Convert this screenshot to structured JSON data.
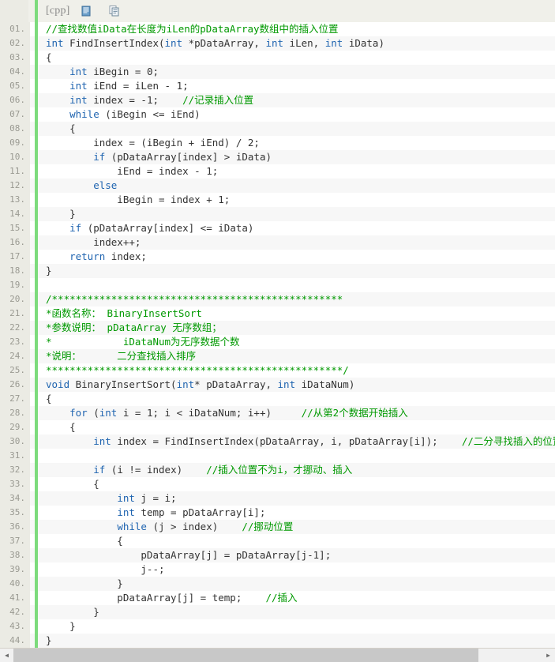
{
  "toolbar": {
    "lang_label": "[cpp]",
    "view_icon_name": "view-plain-icon",
    "copy_icon_name": "copy-to-clipboard-icon"
  },
  "scrollbar": {
    "left_arrow": "◀",
    "right_arrow": "▶"
  },
  "colors": {
    "keyword": "#1f64b0",
    "comment": "#009900",
    "text": "#333333",
    "gutter_bg": "#ebebe4",
    "accent_bar": "#7ddb7d",
    "stripe_bg": "#f7f7f7"
  },
  "code": {
    "language": "cpp",
    "line_count": 44,
    "lines": [
      {
        "n": "01.",
        "segments": [
          {
            "t": "//查找数值iData在长度为iLen的pDataArray数组中的插入位置",
            "c": "cmt"
          }
        ]
      },
      {
        "n": "02.",
        "segments": [
          {
            "t": "int",
            "c": "kw"
          },
          {
            "t": " FindInsertIndex(",
            "c": ""
          },
          {
            "t": "int",
            "c": "kw"
          },
          {
            "t": " *pDataArray, ",
            "c": ""
          },
          {
            "t": "int",
            "c": "kw"
          },
          {
            "t": " iLen, ",
            "c": ""
          },
          {
            "t": "int",
            "c": "kw"
          },
          {
            "t": " iData)",
            "c": ""
          }
        ]
      },
      {
        "n": "03.",
        "segments": [
          {
            "t": "{",
            "c": ""
          }
        ]
      },
      {
        "n": "04.",
        "segments": [
          {
            "t": "    ",
            "c": ""
          },
          {
            "t": "int",
            "c": "kw"
          },
          {
            "t": " iBegin = 0;",
            "c": ""
          }
        ]
      },
      {
        "n": "05.",
        "segments": [
          {
            "t": "    ",
            "c": ""
          },
          {
            "t": "int",
            "c": "kw"
          },
          {
            "t": " iEnd = iLen - 1;",
            "c": ""
          }
        ]
      },
      {
        "n": "06.",
        "segments": [
          {
            "t": "    ",
            "c": ""
          },
          {
            "t": "int",
            "c": "kw"
          },
          {
            "t": " index = -1;    ",
            "c": ""
          },
          {
            "t": "//记录插入位置",
            "c": "cmt"
          }
        ]
      },
      {
        "n": "07.",
        "segments": [
          {
            "t": "    ",
            "c": ""
          },
          {
            "t": "while",
            "c": "kw"
          },
          {
            "t": " (iBegin <= iEnd)",
            "c": ""
          }
        ]
      },
      {
        "n": "08.",
        "segments": [
          {
            "t": "    {",
            "c": ""
          }
        ]
      },
      {
        "n": "09.",
        "segments": [
          {
            "t": "        index = (iBegin + iEnd) / 2;",
            "c": ""
          }
        ]
      },
      {
        "n": "10.",
        "segments": [
          {
            "t": "        ",
            "c": ""
          },
          {
            "t": "if",
            "c": "kw"
          },
          {
            "t": " (pDataArray[index] > iData)",
            "c": ""
          }
        ]
      },
      {
        "n": "11.",
        "segments": [
          {
            "t": "            iEnd = index - 1;",
            "c": ""
          }
        ]
      },
      {
        "n": "12.",
        "segments": [
          {
            "t": "        ",
            "c": ""
          },
          {
            "t": "else",
            "c": "kw"
          }
        ]
      },
      {
        "n": "13.",
        "segments": [
          {
            "t": "            iBegin = index + 1;",
            "c": ""
          }
        ]
      },
      {
        "n": "14.",
        "segments": [
          {
            "t": "    }",
            "c": ""
          }
        ]
      },
      {
        "n": "15.",
        "segments": [
          {
            "t": "    ",
            "c": ""
          },
          {
            "t": "if",
            "c": "kw"
          },
          {
            "t": " (pDataArray[index] <= iData)",
            "c": ""
          }
        ]
      },
      {
        "n": "16.",
        "segments": [
          {
            "t": "        index++;",
            "c": ""
          }
        ]
      },
      {
        "n": "17.",
        "segments": [
          {
            "t": "    ",
            "c": ""
          },
          {
            "t": "return",
            "c": "kw"
          },
          {
            "t": " index;",
            "c": ""
          }
        ]
      },
      {
        "n": "18.",
        "segments": [
          {
            "t": "}",
            "c": ""
          }
        ]
      },
      {
        "n": "19.",
        "segments": [
          {
            "t": "",
            "c": ""
          }
        ]
      },
      {
        "n": "20.",
        "segments": [
          {
            "t": "/*************************************************",
            "c": "cmt"
          }
        ]
      },
      {
        "n": "21.",
        "segments": [
          {
            "t": "*函数名称： BinaryInsertSort",
            "c": "cmt"
          }
        ]
      },
      {
        "n": "22.",
        "segments": [
          {
            "t": "*参数说明： pDataArray 无序数组；",
            "c": "cmt"
          }
        ]
      },
      {
        "n": "23.",
        "segments": [
          {
            "t": "*            iDataNum为无序数据个数",
            "c": "cmt"
          }
        ]
      },
      {
        "n": "24.",
        "segments": [
          {
            "t": "*说明：      二分查找插入排序",
            "c": "cmt"
          }
        ]
      },
      {
        "n": "25.",
        "segments": [
          {
            "t": "**************************************************/",
            "c": "cmt"
          }
        ]
      },
      {
        "n": "26.",
        "segments": [
          {
            "t": "void",
            "c": "kw"
          },
          {
            "t": " BinaryInsertSort(",
            "c": ""
          },
          {
            "t": "int",
            "c": "kw"
          },
          {
            "t": "* pDataArray, ",
            "c": ""
          },
          {
            "t": "int",
            "c": "kw"
          },
          {
            "t": " iDataNum)",
            "c": ""
          }
        ]
      },
      {
        "n": "27.",
        "segments": [
          {
            "t": "{",
            "c": ""
          }
        ]
      },
      {
        "n": "28.",
        "segments": [
          {
            "t": "    ",
            "c": ""
          },
          {
            "t": "for",
            "c": "kw"
          },
          {
            "t": " (",
            "c": ""
          },
          {
            "t": "int",
            "c": "kw"
          },
          {
            "t": " i = 1; i < iDataNum; i++)     ",
            "c": ""
          },
          {
            "t": "//从第2个数据开始插入",
            "c": "cmt"
          }
        ]
      },
      {
        "n": "29.",
        "segments": [
          {
            "t": "    {",
            "c": ""
          }
        ]
      },
      {
        "n": "30.",
        "segments": [
          {
            "t": "        ",
            "c": ""
          },
          {
            "t": "int",
            "c": "kw"
          },
          {
            "t": " index = FindInsertIndex(pDataArray, i, pDataArray[i]);    ",
            "c": ""
          },
          {
            "t": "//二分寻找插入的位置",
            "c": "cmt"
          }
        ]
      },
      {
        "n": "31.",
        "segments": [
          {
            "t": "",
            "c": ""
          }
        ]
      },
      {
        "n": "32.",
        "segments": [
          {
            "t": "        ",
            "c": ""
          },
          {
            "t": "if",
            "c": "kw"
          },
          {
            "t": " (i != index)    ",
            "c": ""
          },
          {
            "t": "//插入位置不为i，才挪动、插入",
            "c": "cmt"
          }
        ]
      },
      {
        "n": "33.",
        "segments": [
          {
            "t": "        {",
            "c": ""
          }
        ]
      },
      {
        "n": "34.",
        "segments": [
          {
            "t": "            ",
            "c": ""
          },
          {
            "t": "int",
            "c": "kw"
          },
          {
            "t": " j = i;",
            "c": ""
          }
        ]
      },
      {
        "n": "35.",
        "segments": [
          {
            "t": "            ",
            "c": ""
          },
          {
            "t": "int",
            "c": "kw"
          },
          {
            "t": " temp = pDataArray[i];",
            "c": ""
          }
        ]
      },
      {
        "n": "36.",
        "segments": [
          {
            "t": "            ",
            "c": ""
          },
          {
            "t": "while",
            "c": "kw"
          },
          {
            "t": " (j > index)    ",
            "c": ""
          },
          {
            "t": "//挪动位置",
            "c": "cmt"
          }
        ]
      },
      {
        "n": "37.",
        "segments": [
          {
            "t": "            {",
            "c": ""
          }
        ]
      },
      {
        "n": "38.",
        "segments": [
          {
            "t": "                pDataArray[j] = pDataArray[j-1];",
            "c": ""
          }
        ]
      },
      {
        "n": "39.",
        "segments": [
          {
            "t": "                j--;",
            "c": ""
          }
        ]
      },
      {
        "n": "40.",
        "segments": [
          {
            "t": "            }",
            "c": ""
          }
        ]
      },
      {
        "n": "41.",
        "segments": [
          {
            "t": "            pDataArray[j] = temp;    ",
            "c": ""
          },
          {
            "t": "//插入",
            "c": "cmt"
          }
        ]
      },
      {
        "n": "42.",
        "segments": [
          {
            "t": "        }",
            "c": ""
          }
        ]
      },
      {
        "n": "43.",
        "segments": [
          {
            "t": "    }",
            "c": ""
          }
        ]
      },
      {
        "n": "44.",
        "segments": [
          {
            "t": "}",
            "c": ""
          }
        ]
      }
    ]
  }
}
